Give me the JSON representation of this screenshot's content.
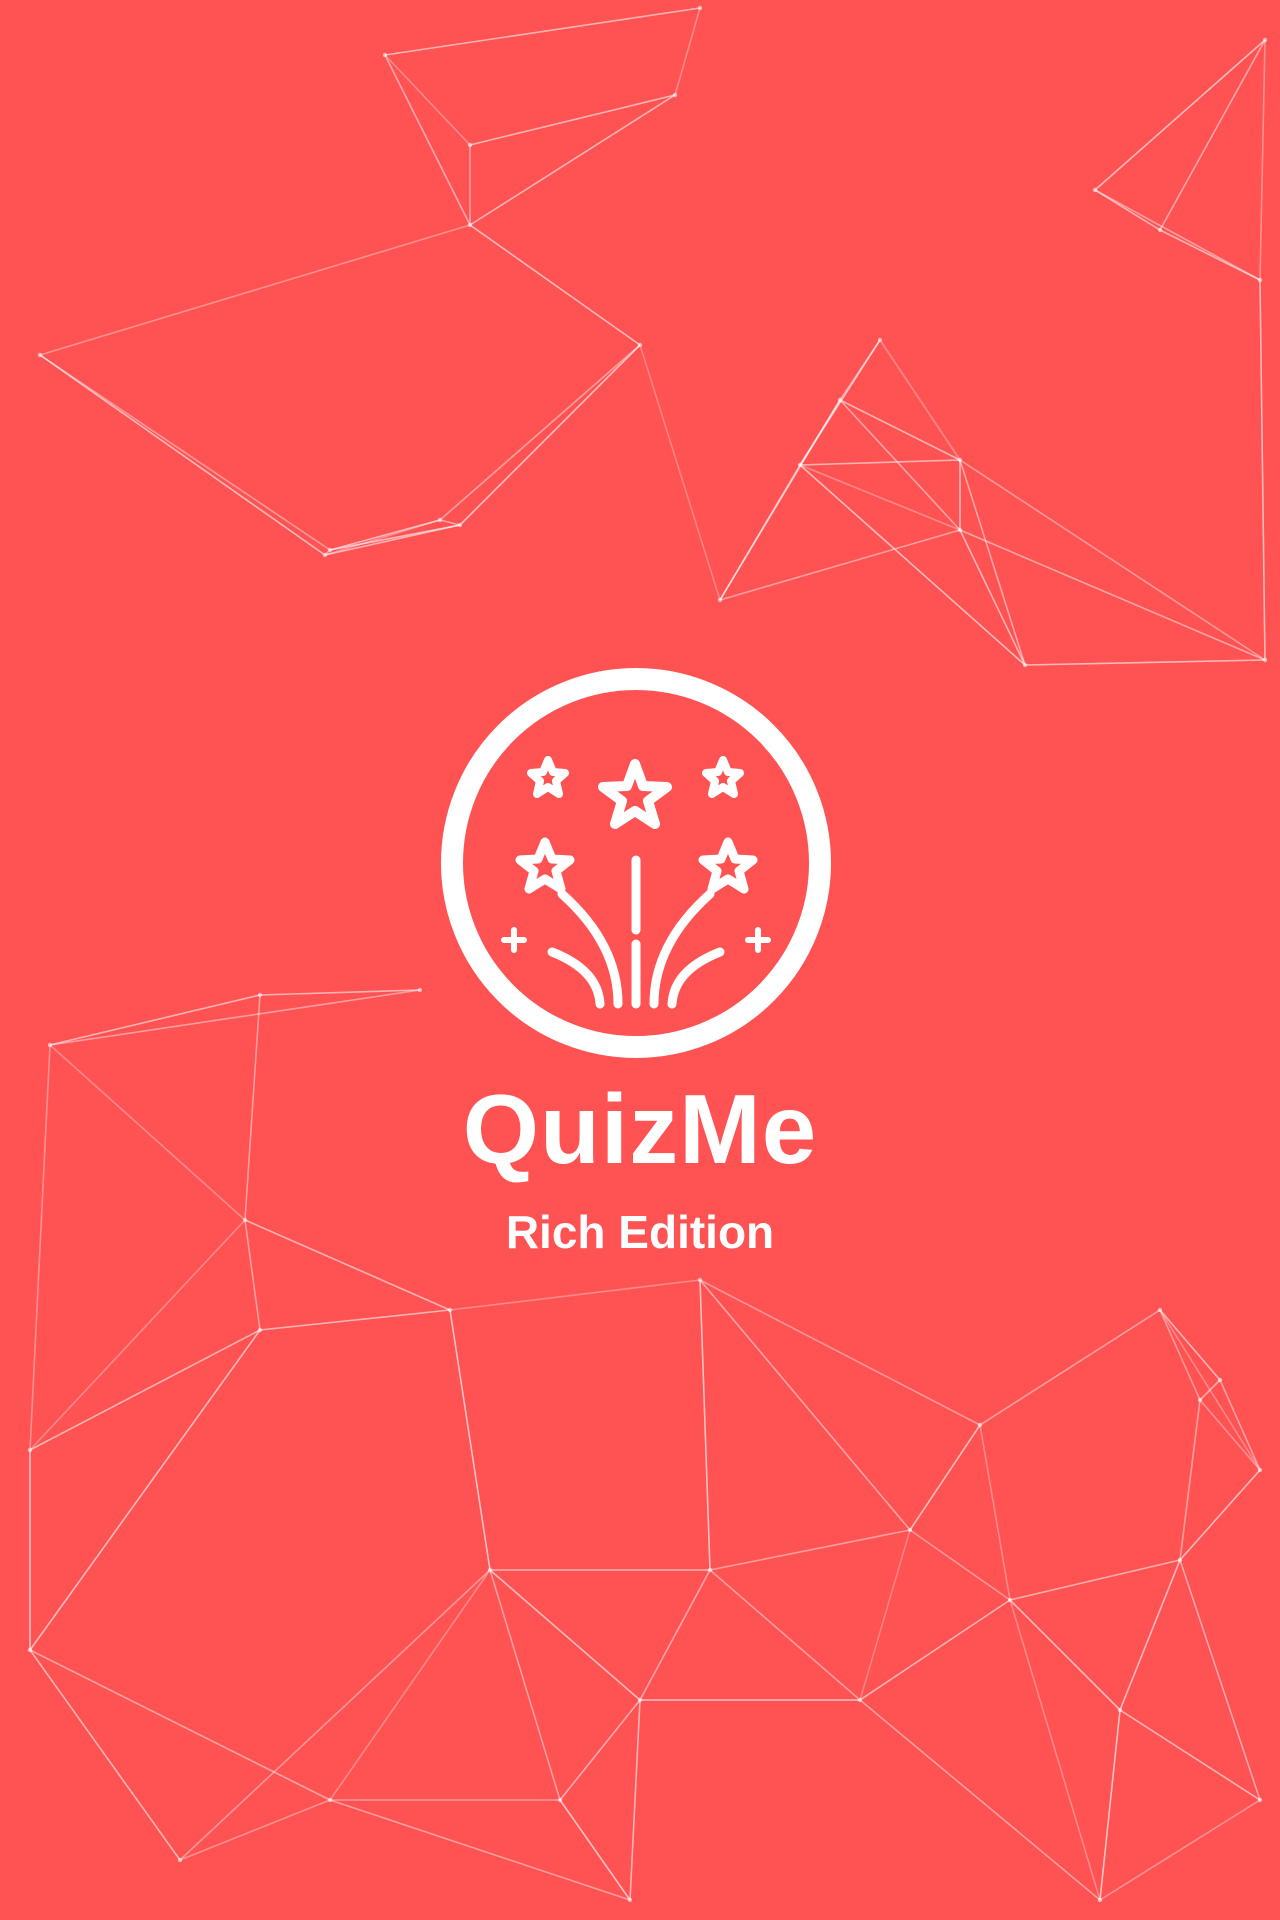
{
  "app": {
    "name": "QuizMe",
    "edition": "Rich Edition"
  },
  "colors": {
    "background": "#ff5253",
    "foreground": "#ffffff"
  },
  "icons": {
    "logo": "fireworks-stars-icon"
  }
}
